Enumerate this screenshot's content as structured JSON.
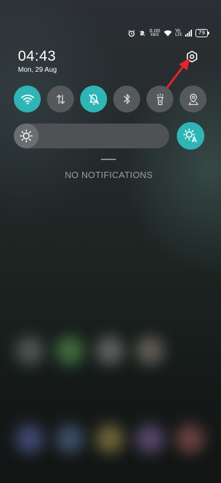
{
  "status_bar": {
    "icons": [
      "alarm-icon",
      "do-not-disturb-icon",
      "wifi-icon",
      "signal-icon"
    ],
    "speed_value": "0.00",
    "speed_unit": "KB/S",
    "network_tag": "Vo LTE",
    "battery": "79"
  },
  "header": {
    "time": "04:43",
    "date": "Mon, 29 Aug"
  },
  "quick_toggles": [
    {
      "name": "wifi",
      "state": "on"
    },
    {
      "name": "mobile-data",
      "state": "off"
    },
    {
      "name": "silent-mode",
      "state": "on"
    },
    {
      "name": "bluetooth",
      "state": "off"
    },
    {
      "name": "flashlight",
      "state": "off"
    },
    {
      "name": "location",
      "state": "off"
    }
  ],
  "brightness": {
    "level": 0.16
  },
  "notifications": {
    "empty_text": "NO NOTIFICATIONS"
  },
  "colors": {
    "accent": "#2fb5b6",
    "annotation_arrow": "#e3262b"
  }
}
